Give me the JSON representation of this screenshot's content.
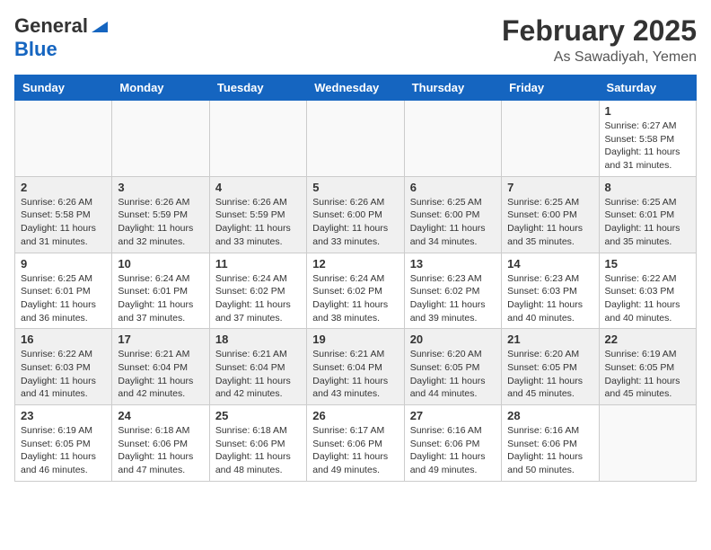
{
  "header": {
    "logo_general": "General",
    "logo_blue": "Blue",
    "month": "February 2025",
    "location": "As Sawadiyah, Yemen"
  },
  "days_of_week": [
    "Sunday",
    "Monday",
    "Tuesday",
    "Wednesday",
    "Thursday",
    "Friday",
    "Saturday"
  ],
  "weeks": [
    {
      "shaded": false,
      "days": [
        {
          "empty": true
        },
        {
          "empty": true
        },
        {
          "empty": true
        },
        {
          "empty": true
        },
        {
          "empty": true
        },
        {
          "empty": true
        },
        {
          "num": "1",
          "sunrise": "6:27 AM",
          "sunset": "5:58 PM",
          "daylight": "11 hours and 31 minutes."
        }
      ]
    },
    {
      "shaded": true,
      "days": [
        {
          "num": "2",
          "sunrise": "6:26 AM",
          "sunset": "5:58 PM",
          "daylight": "11 hours and 31 minutes."
        },
        {
          "num": "3",
          "sunrise": "6:26 AM",
          "sunset": "5:59 PM",
          "daylight": "11 hours and 32 minutes."
        },
        {
          "num": "4",
          "sunrise": "6:26 AM",
          "sunset": "5:59 PM",
          "daylight": "11 hours and 33 minutes."
        },
        {
          "num": "5",
          "sunrise": "6:26 AM",
          "sunset": "6:00 PM",
          "daylight": "11 hours and 33 minutes."
        },
        {
          "num": "6",
          "sunrise": "6:25 AM",
          "sunset": "6:00 PM",
          "daylight": "11 hours and 34 minutes."
        },
        {
          "num": "7",
          "sunrise": "6:25 AM",
          "sunset": "6:00 PM",
          "daylight": "11 hours and 35 minutes."
        },
        {
          "num": "8",
          "sunrise": "6:25 AM",
          "sunset": "6:01 PM",
          "daylight": "11 hours and 35 minutes."
        }
      ]
    },
    {
      "shaded": false,
      "days": [
        {
          "num": "9",
          "sunrise": "6:25 AM",
          "sunset": "6:01 PM",
          "daylight": "11 hours and 36 minutes."
        },
        {
          "num": "10",
          "sunrise": "6:24 AM",
          "sunset": "6:01 PM",
          "daylight": "11 hours and 37 minutes."
        },
        {
          "num": "11",
          "sunrise": "6:24 AM",
          "sunset": "6:02 PM",
          "daylight": "11 hours and 37 minutes."
        },
        {
          "num": "12",
          "sunrise": "6:24 AM",
          "sunset": "6:02 PM",
          "daylight": "11 hours and 38 minutes."
        },
        {
          "num": "13",
          "sunrise": "6:23 AM",
          "sunset": "6:02 PM",
          "daylight": "11 hours and 39 minutes."
        },
        {
          "num": "14",
          "sunrise": "6:23 AM",
          "sunset": "6:03 PM",
          "daylight": "11 hours and 40 minutes."
        },
        {
          "num": "15",
          "sunrise": "6:22 AM",
          "sunset": "6:03 PM",
          "daylight": "11 hours and 40 minutes."
        }
      ]
    },
    {
      "shaded": true,
      "days": [
        {
          "num": "16",
          "sunrise": "6:22 AM",
          "sunset": "6:03 PM",
          "daylight": "11 hours and 41 minutes."
        },
        {
          "num": "17",
          "sunrise": "6:21 AM",
          "sunset": "6:04 PM",
          "daylight": "11 hours and 42 minutes."
        },
        {
          "num": "18",
          "sunrise": "6:21 AM",
          "sunset": "6:04 PM",
          "daylight": "11 hours and 42 minutes."
        },
        {
          "num": "19",
          "sunrise": "6:21 AM",
          "sunset": "6:04 PM",
          "daylight": "11 hours and 43 minutes."
        },
        {
          "num": "20",
          "sunrise": "6:20 AM",
          "sunset": "6:05 PM",
          "daylight": "11 hours and 44 minutes."
        },
        {
          "num": "21",
          "sunrise": "6:20 AM",
          "sunset": "6:05 PM",
          "daylight": "11 hours and 45 minutes."
        },
        {
          "num": "22",
          "sunrise": "6:19 AM",
          "sunset": "6:05 PM",
          "daylight": "11 hours and 45 minutes."
        }
      ]
    },
    {
      "shaded": false,
      "days": [
        {
          "num": "23",
          "sunrise": "6:19 AM",
          "sunset": "6:05 PM",
          "daylight": "11 hours and 46 minutes."
        },
        {
          "num": "24",
          "sunrise": "6:18 AM",
          "sunset": "6:06 PM",
          "daylight": "11 hours and 47 minutes."
        },
        {
          "num": "25",
          "sunrise": "6:18 AM",
          "sunset": "6:06 PM",
          "daylight": "11 hours and 48 minutes."
        },
        {
          "num": "26",
          "sunrise": "6:17 AM",
          "sunset": "6:06 PM",
          "daylight": "11 hours and 49 minutes."
        },
        {
          "num": "27",
          "sunrise": "6:16 AM",
          "sunset": "6:06 PM",
          "daylight": "11 hours and 49 minutes."
        },
        {
          "num": "28",
          "sunrise": "6:16 AM",
          "sunset": "6:06 PM",
          "daylight": "11 hours and 50 minutes."
        },
        {
          "empty": true
        }
      ]
    }
  ]
}
